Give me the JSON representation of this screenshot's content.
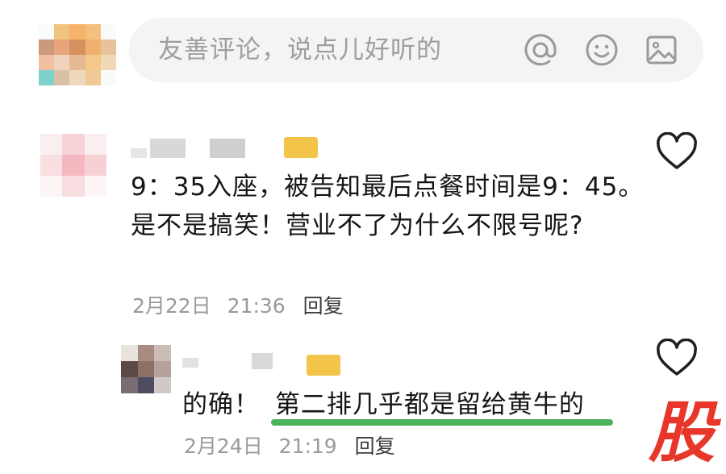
{
  "composer": {
    "placeholder": "友善评论，说点儿好听的",
    "icons": [
      "at-icon",
      "emoji-icon",
      "image-icon"
    ]
  },
  "comment": {
    "text": "9：35入座，被告知最后点餐时间是9：45。是不是搞笑！营业不了为什么不限号呢?",
    "date": "2月22日",
    "time": "21:36",
    "reply_label": "回复"
  },
  "reply": {
    "text_prefix": "的确！",
    "text_highlight": "第二排几乎都是留给黄牛的",
    "date": "2月24日",
    "time": "21:19",
    "reply_label": "回复",
    "highlight_color": "#4bb35a"
  },
  "watermark": "股",
  "colors": {
    "accent_badge": "#f3c44a",
    "watermark": "#e8362b"
  }
}
